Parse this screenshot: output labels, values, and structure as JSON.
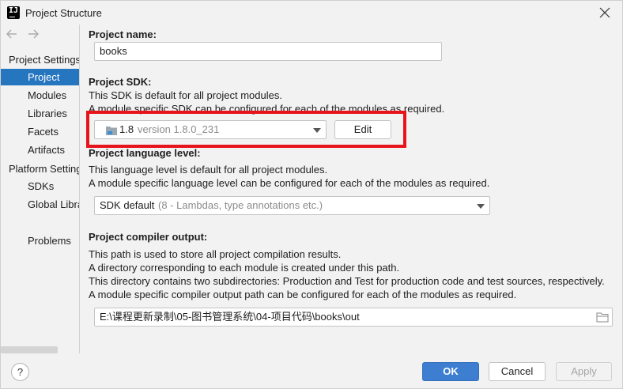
{
  "window": {
    "title": "Project Structure"
  },
  "nav": {
    "back_icon": "arrow-left-icon",
    "forward_icon": "arrow-right-icon"
  },
  "sidebar": {
    "project_settings_header": "Project Settings",
    "project_settings_items": [
      "Project",
      "Modules",
      "Libraries",
      "Facets",
      "Artifacts"
    ],
    "platform_settings_header": "Platform Settings",
    "platform_settings_items": [
      "SDKs",
      "Global Libraries"
    ],
    "problems": "Problems",
    "selected": "Project"
  },
  "main": {
    "project_name": {
      "label": "Project name:",
      "value": "books"
    },
    "project_sdk": {
      "label": "Project SDK:",
      "desc1": "This SDK is default for all project modules.",
      "desc2": "A module specific SDK can be configured for each of the modules as required.",
      "selected_name": "1.8",
      "selected_version": "version 1.8.0_231",
      "edit_label": "Edit"
    },
    "language_level": {
      "label": "Project language level:",
      "desc1": "This language level is default for all project modules.",
      "desc2": "A module specific language level can be configured for each of the modules as required.",
      "selected_name": "SDK default",
      "selected_detail": "(8 - Lambdas, type annotations etc.)"
    },
    "compiler_output": {
      "label": "Project compiler output:",
      "desc1": "This path is used to store all project compilation results.",
      "desc2": "A directory corresponding to each module is created under this path.",
      "desc3": "This directory contains two subdirectories: Production and Test for production code and test sources, respectively.",
      "desc4": "A module specific compiler output path can be configured for each of the modules as required.",
      "path": "E:\\课程更新录制\\05-图书管理系统\\04-项目代码\\books\\out"
    }
  },
  "footer": {
    "help": "?",
    "ok": "OK",
    "cancel": "Cancel",
    "apply": "Apply"
  },
  "colors": {
    "accent": "#3d7ed1",
    "selection": "#2675bf",
    "highlight": "#e8141b"
  }
}
